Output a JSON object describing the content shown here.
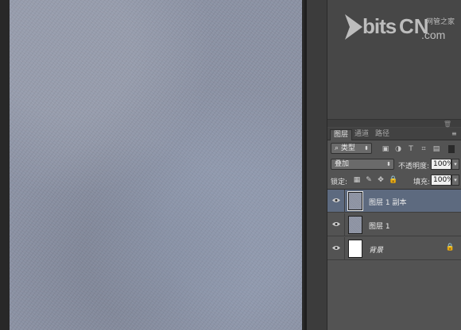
{
  "watermark": {
    "bits": "bits",
    "cn": "CN",
    "com": ".com",
    "net": "网管之家"
  },
  "layers_panel": {
    "tabs": [
      {
        "label": "图层"
      },
      {
        "label": "通道"
      },
      {
        "label": "路径"
      }
    ],
    "filter": {
      "kind_label": "类型",
      "icons": [
        "image-filter-icon",
        "adjustment-filter-icon",
        "type-filter-icon",
        "shape-filter-icon",
        "smart-object-filter-icon"
      ]
    },
    "blend_mode": "叠加",
    "opacity_label": "不透明度:",
    "opacity_value": "100%",
    "lock_label": "锁定:",
    "fill_label": "填充:",
    "fill_value": "100%",
    "layers": [
      {
        "name": "图层 1 副本",
        "selected": true,
        "thumb": "texture"
      },
      {
        "name": "图层 1",
        "selected": false,
        "thumb": "texture"
      },
      {
        "name": "背景",
        "selected": false,
        "thumb": "white",
        "locked": true
      }
    ]
  }
}
